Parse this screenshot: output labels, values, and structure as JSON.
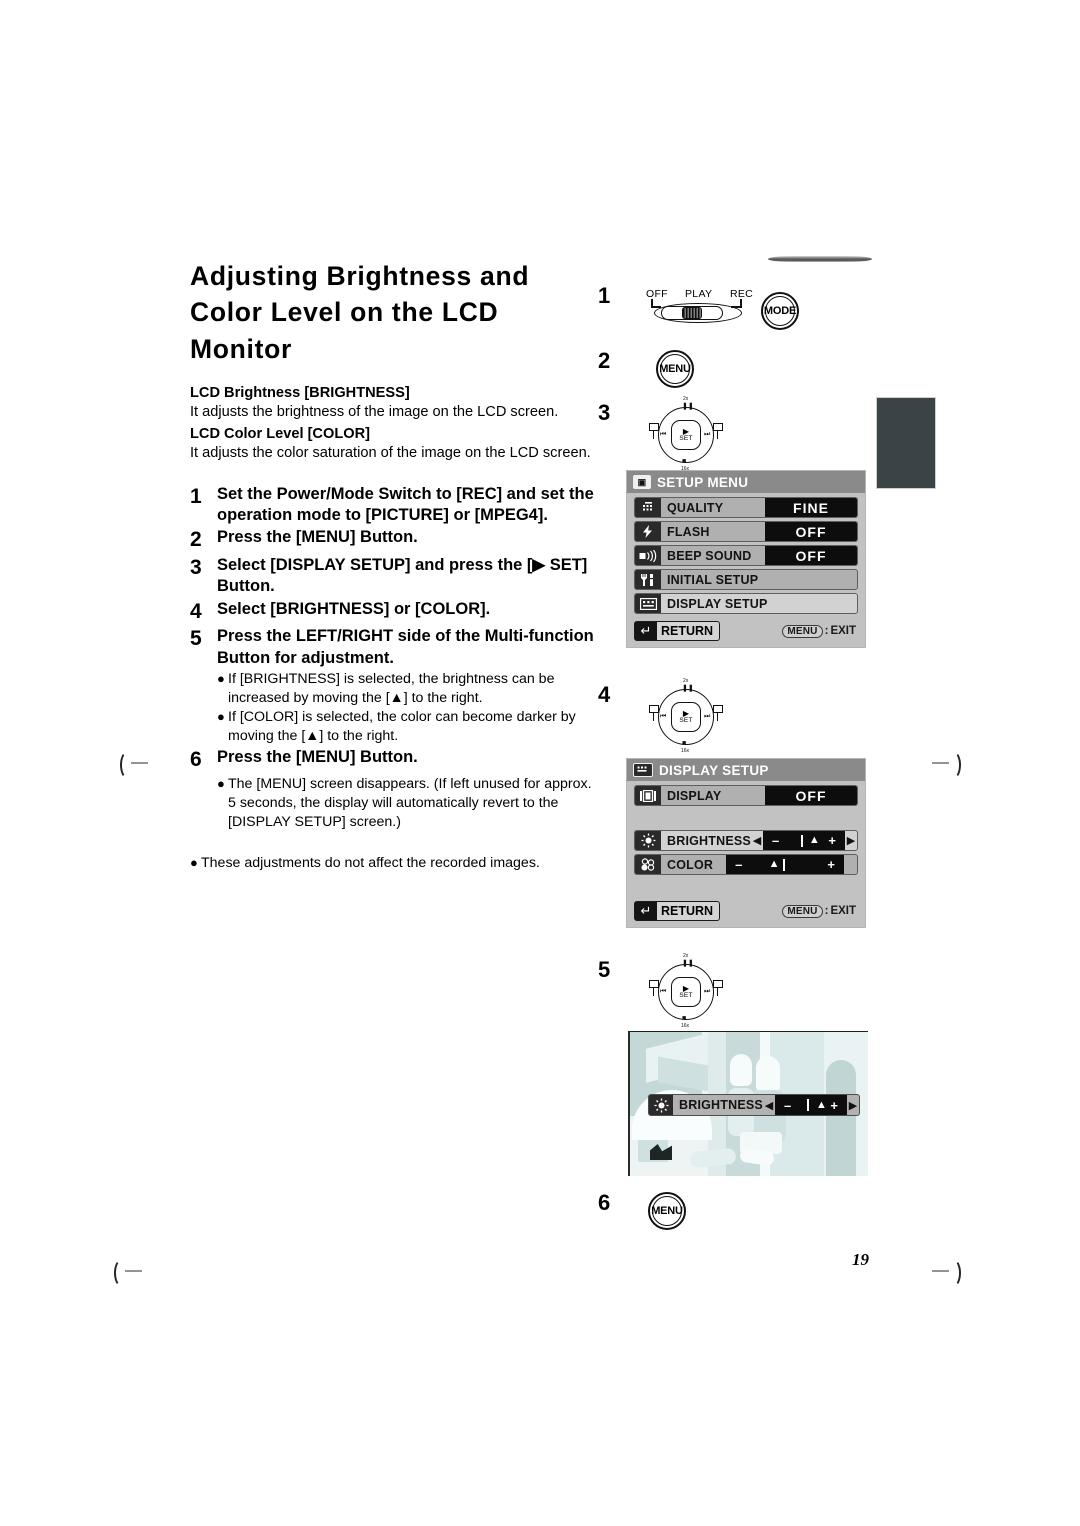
{
  "page": {
    "title": "Adjusting Brightness and Color Level on the LCD Monitor",
    "number": "19"
  },
  "intro": {
    "brightness_heading": "LCD Brightness [BRIGHTNESS]",
    "brightness_body": "It adjusts the brightness of the image on the LCD screen.",
    "color_heading": "LCD Color Level [COLOR]",
    "color_body": "It adjusts the color saturation of the image on the LCD screen."
  },
  "steps": [
    {
      "num": "1",
      "text": "Set the Power/Mode Switch to [REC] and set the operation mode to [PICTURE] or [MPEG4]."
    },
    {
      "num": "2",
      "text": "Press the [MENU] Button."
    },
    {
      "num": "3",
      "text": "Select [DISPLAY SETUP] and press the [▶ SET] Button."
    },
    {
      "num": "4",
      "text": "Select [BRIGHTNESS] or [COLOR]."
    },
    {
      "num": "5",
      "text": "Press the LEFT/RIGHT side of the Multi-function Button for adjustment."
    },
    {
      "num": "6",
      "text": "Press the [MENU] Button."
    }
  ],
  "step5_bullets": [
    "If [BRIGHTNESS] is selected, the brightness can be increased by moving the [▲] to the right.",
    "If [COLOR] is selected, the color can become darker by moving the [▲] to the right."
  ],
  "step6_bullets": [
    "The [MENU] screen disappears. (If left unused for approx. 5 seconds, the display will automatically revert to the [DISPLAY SETUP] screen.)"
  ],
  "final_note": [
    "These adjustments do not affect the recorded images."
  ],
  "right_steps": {
    "one": "1",
    "two": "2",
    "three": "3",
    "four": "4",
    "five": "5",
    "six": "6"
  },
  "power_switch": {
    "off": "OFF",
    "play": "PLAY",
    "rec": "REC"
  },
  "buttons": {
    "mode": "MODE",
    "menu": "MENU"
  },
  "multifunction": {
    "zoom_label": "2x",
    "pause_glyph": "❚❚",
    "stop_glyph": "■",
    "stop_label": "16x",
    "prev_glyph": "⏮",
    "next_glyph": "⏭",
    "play_glyph": "▶",
    "set_label": "SET"
  },
  "setup_menu": {
    "title": "SETUP MENU",
    "title_icon": "camera-icon",
    "rows": [
      {
        "icon": "quality-grid-icon",
        "label": "QUALITY",
        "value": "FINE",
        "selected": false
      },
      {
        "icon": "flash-bolt-icon",
        "label": "FLASH",
        "value": "OFF",
        "selected": false
      },
      {
        "icon": "beep-speaker-icon",
        "label": "BEEP SOUND",
        "value": "OFF",
        "selected": false
      },
      {
        "icon": "initial-setup-icon",
        "label": "INITIAL SETUP",
        "value": "",
        "selected": false
      },
      {
        "icon": "display-setup-icon",
        "label": "DISPLAY SETUP",
        "value": "",
        "selected": true
      }
    ],
    "return_label": "RETURN",
    "exit_key": "MENU",
    "exit_colon": ":",
    "exit_label": "EXIT"
  },
  "display_setup": {
    "title": "DISPLAY SETUP",
    "title_icon": "display-setup-icon",
    "display_row": {
      "icon": "display-icon",
      "label": "DISPLAY",
      "value": "OFF"
    },
    "brightness_row": {
      "icon": "sun-icon",
      "label": "BRIGHTNESS",
      "left_arrow": "◀",
      "right_arrow": "▶",
      "minus": "–",
      "plus": "+",
      "marker": "▲",
      "selected": true
    },
    "color_row": {
      "icon": "color-dots-icon",
      "label": "COLOR",
      "minus": "–",
      "plus": "+",
      "marker": "▲",
      "selected": false
    },
    "return_label": "RETURN",
    "exit_key": "MENU",
    "exit_colon": ":",
    "exit_label": "EXIT"
  },
  "preview_osd": {
    "icon": "sun-icon",
    "label": "BRIGHTNESS",
    "left_arrow": "◀",
    "right_arrow": "▶",
    "minus": "–",
    "plus": "+",
    "marker": "▲"
  },
  "colors": {
    "osd_header": "#8a8a8a",
    "osd_body": "#c2c2c2",
    "osd_value_bg": "#0d0d0d",
    "tab": "#3b4346"
  }
}
